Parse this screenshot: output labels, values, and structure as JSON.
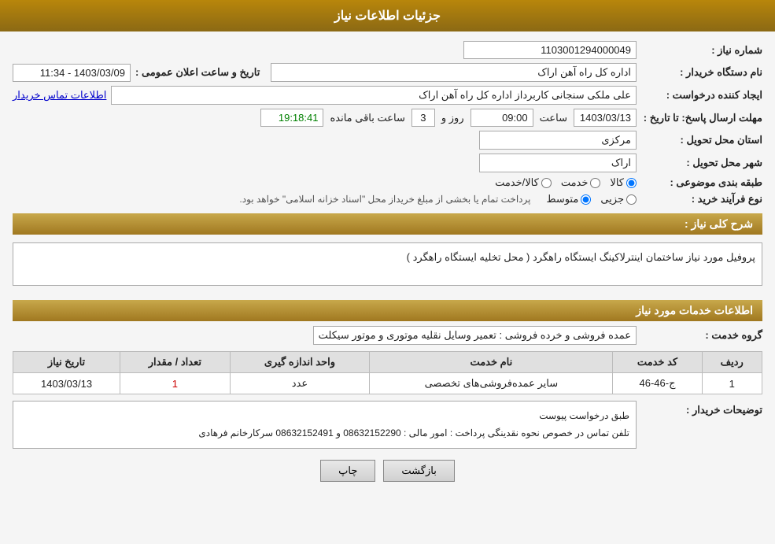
{
  "header": {
    "title": "جزئیات اطلاعات نیاز"
  },
  "fields": {
    "need_number_label": "شماره نیاز :",
    "need_number_value": "1103001294000049",
    "buyer_station_label": "نام دستگاه خریدار :",
    "buyer_station_value": "اداره کل راه آهن اراک",
    "creator_label": "ایجاد کننده درخواست :",
    "creator_value": "علی ملکی سنجانی کاربرداز اداره کل راه آهن اراک",
    "creator_link": "اطلاعات تماس خریدار",
    "deadline_label": "مهلت ارسال پاسخ: تا تاریخ :",
    "deadline_date": "1403/03/13",
    "deadline_time_label": "ساعت",
    "deadline_time": "09:00",
    "deadline_days_label": "روز و",
    "deadline_days": "3",
    "remaining_label": "ساعت باقی مانده",
    "remaining_time": "19:18:41",
    "province_label": "استان محل تحویل :",
    "province_value": "مرکزی",
    "city_label": "شهر محل تحویل :",
    "city_value": "اراک",
    "type_label": "طبقه بندی موضوعی :",
    "type_options": [
      "کالا",
      "خدمت",
      "کالا/خدمت"
    ],
    "type_selected": "کالا",
    "process_label": "نوع فرآیند خرید :",
    "process_options": [
      "جزیی",
      "متوسط"
    ],
    "process_note": "پرداخت تمام یا بخشی از مبلغ خریداز محل \"اسناد خزانه اسلامی\" خواهد بود.",
    "announce_label": "تاریخ و ساعت اعلان عمومی :",
    "announce_value": "1403/03/09 - 11:34",
    "description_section": "شرح کلی نیاز :",
    "description_value": "پروفیل مورد نیاز ساختمان اینترلاکینگ ایستگاه راهگرد ( محل تخلیه ایستگاه راهگرد )",
    "services_section": "اطلاعات خدمات مورد نیاز",
    "group_service_label": "گروه خدمت :",
    "group_service_value": "عمده فروشی و خرده فروشی : تعمیر وسایل نقلیه موتوری و موتور سیکلت",
    "table": {
      "columns": [
        "ردیف",
        "کد خدمت",
        "نام خدمت",
        "واحد اندازه گیری",
        "تعداد / مقدار",
        "تاریخ نیاز"
      ],
      "rows": [
        {
          "row": "1",
          "code": "ج-46-46",
          "name": "سایر عمده‌فروشی‌های تخصصی",
          "unit": "عدد",
          "qty": "1",
          "date": "1403/03/13"
        }
      ]
    },
    "buyer_notes_label": "توضیحات خریدار :",
    "buyer_notes_value": "طبق درخواست پیوست\nتلفن تماس در خصوص نحوه نقدینگی پرداخت : امور مالی : 08632152290 و 08632152491 سرکارخانم فرهادی"
  },
  "buttons": {
    "back_label": "بازگشت",
    "print_label": "چاپ"
  }
}
